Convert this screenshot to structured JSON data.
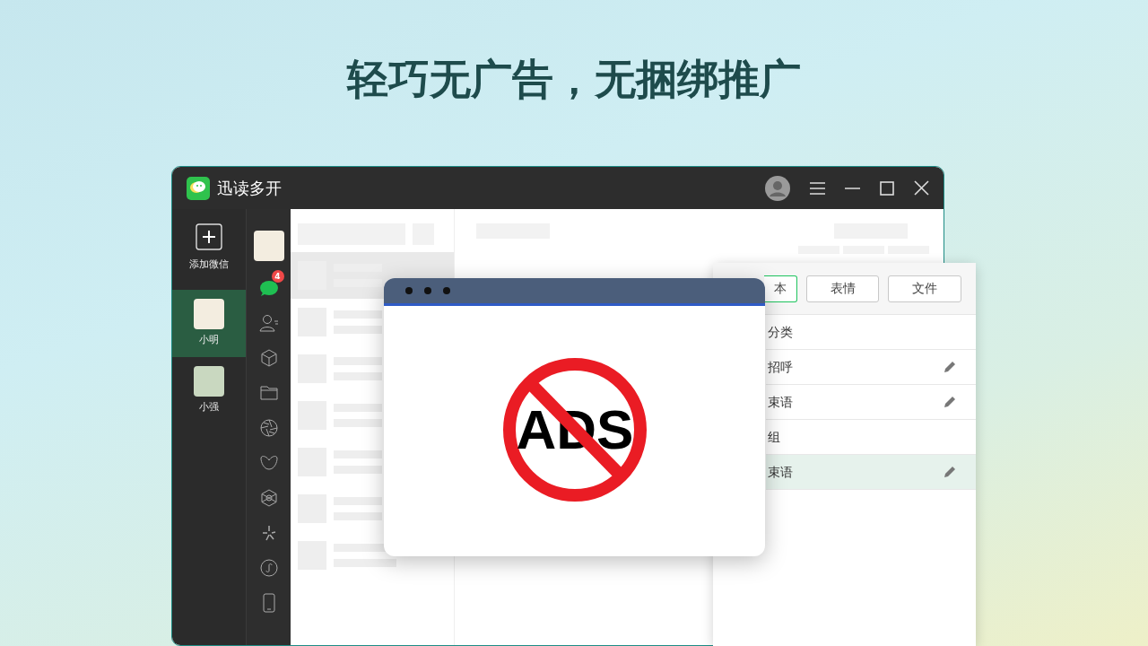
{
  "headline": "轻巧无广告，无捆绑推广",
  "app_window": {
    "title": "迅读多开",
    "accounts_sidebar": {
      "add_label": "添加微信",
      "accounts": [
        {
          "name": "小明",
          "selected": true
        },
        {
          "name": "小强",
          "selected": false
        }
      ]
    },
    "nav_rail": {
      "unread_badge": "4"
    }
  },
  "ad_window": {
    "sign_text": "ADS"
  },
  "reply_panel": {
    "tabs": [
      {
        "label": "本",
        "selected": true
      },
      {
        "label": "表情",
        "selected": false
      },
      {
        "label": "文件",
        "selected": false
      }
    ],
    "items": [
      {
        "label": "分类",
        "editable": false,
        "selected": false
      },
      {
        "label": "招呼",
        "editable": true,
        "selected": false
      },
      {
        "label": "束语",
        "editable": true,
        "selected": false
      },
      {
        "label": "组",
        "editable": false,
        "selected": false
      },
      {
        "label": "束语",
        "editable": true,
        "selected": true
      }
    ]
  }
}
